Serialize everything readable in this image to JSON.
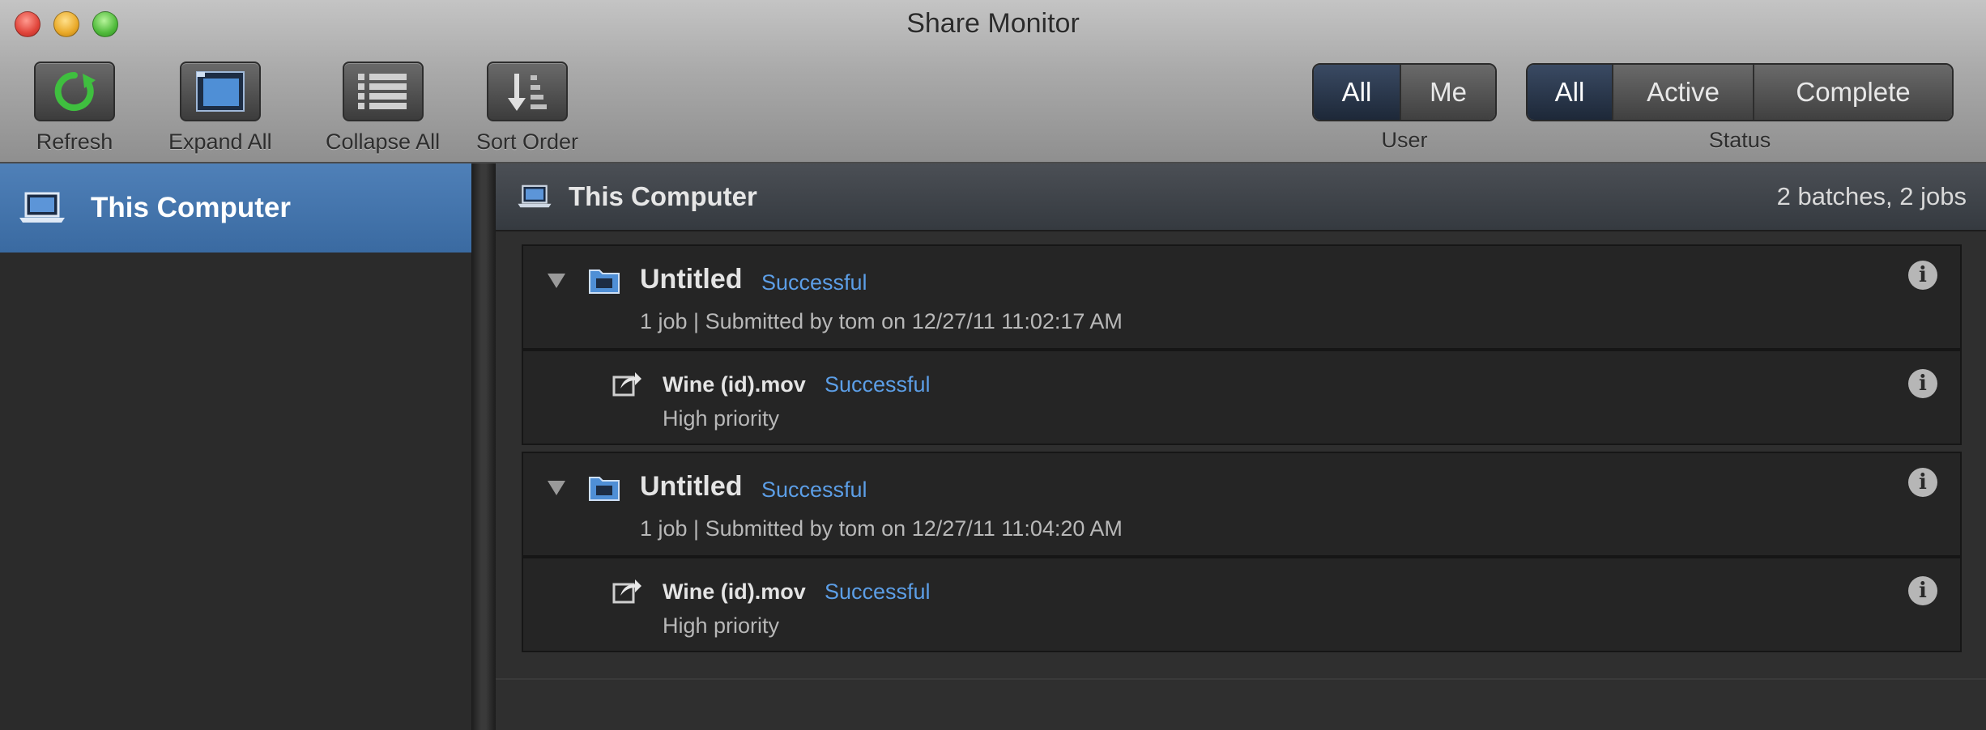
{
  "window": {
    "title": "Share Monitor"
  },
  "toolbar": {
    "refresh_label": "Refresh",
    "expand_label": "Expand All",
    "collapse_label": "Collapse All",
    "sort_label": "Sort Order",
    "user_filter": {
      "label": "User",
      "options": [
        "All",
        "Me"
      ],
      "selected": "All"
    },
    "status_filter": {
      "label": "Status",
      "options": [
        "All",
        "Active",
        "Complete"
      ],
      "selected": "All"
    }
  },
  "sidebar": {
    "items": [
      {
        "label": "This Computer",
        "icon": "laptop-icon",
        "selected": true
      }
    ]
  },
  "main": {
    "header": {
      "title": "This Computer",
      "count": "2 batches, 2 jobs"
    },
    "batches": [
      {
        "title": "Untitled",
        "status": "Successful",
        "subtitle": "1 job  |  Submitted by tom on 12/27/11 11:02:17 AM",
        "jobs": [
          {
            "title": "Wine (id).mov",
            "status": "Successful",
            "priority": "High priority"
          }
        ]
      },
      {
        "title": "Untitled",
        "status": "Successful",
        "subtitle": "1 job  |  Submitted by tom on 12/27/11 11:04:20 AM",
        "jobs": [
          {
            "title": "Wine (id).mov",
            "status": "Successful",
            "priority": "High priority"
          }
        ]
      }
    ]
  },
  "colors": {
    "accent_blue": "#5c9ee6",
    "selection": "#4a7bb4"
  }
}
